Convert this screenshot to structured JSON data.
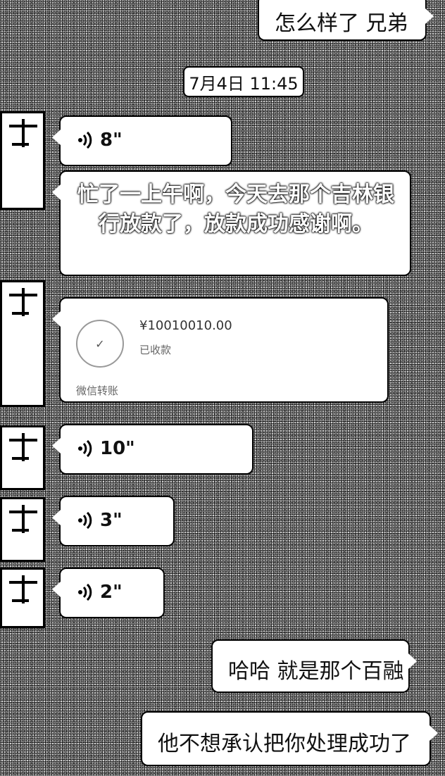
{
  "messages": {
    "m1": "怎么样了 兄弟",
    "timestamp": "7月4日 11:45",
    "v1": "8\"",
    "m2": "忙了一上午啊，今天去那个吉林银行放款了，放款成功感谢啊。",
    "transfer": {
      "amount": "¥10010010.00",
      "status": "已收款",
      "footer": "微信转账"
    },
    "v2": "10\"",
    "v3": "3\"",
    "v4": "2\"",
    "m3": "哈哈  就是那个百融",
    "m4": "他不想承认把你处理成功了"
  },
  "icons": {
    "voice": "voice-wave-icon"
  }
}
